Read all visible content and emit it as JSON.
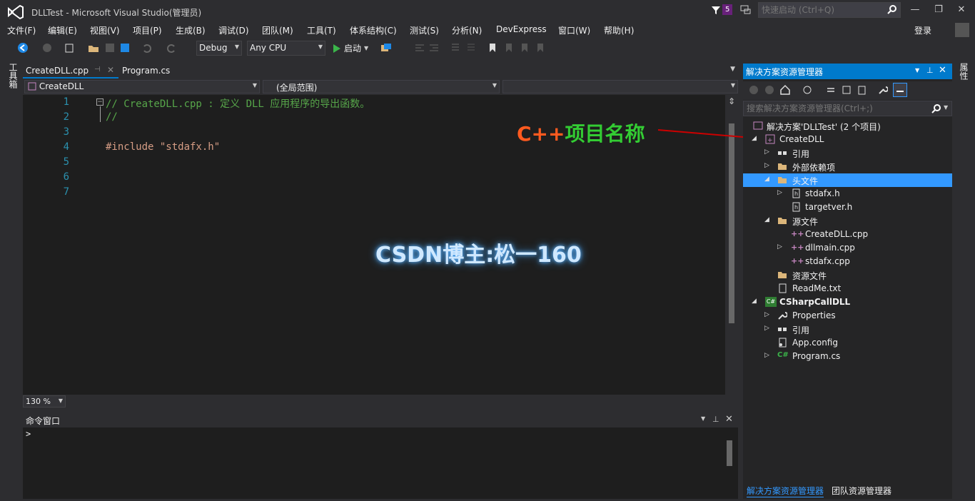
{
  "window": {
    "title": "DLLTest - Microsoft Visual Studio(管理员)",
    "notification_count": "5",
    "quick_launch_placeholder": "快速启动 (Ctrl+Q)",
    "login": "登录"
  },
  "menu": [
    "文件(F)",
    "编辑(E)",
    "视图(V)",
    "项目(P)",
    "生成(B)",
    "调试(D)",
    "团队(M)",
    "工具(T)",
    "体系结构(C)",
    "测试(S)",
    "分析(N)",
    "DevExpress",
    "窗口(W)",
    "帮助(H)"
  ],
  "toolbar": {
    "config": "Debug",
    "platform": "Any CPU",
    "start_label": "启动"
  },
  "side": {
    "toolbox": "工具箱",
    "properties": "属性"
  },
  "editor": {
    "tabs": [
      "CreateDLL.cpp",
      "Program.cs"
    ],
    "nav_project": "CreateDLL",
    "nav_scope": "(全局范围)",
    "zoom": "130 %",
    "line_numbers": [
      "1",
      "2",
      "3",
      "4",
      "5",
      "6",
      "7"
    ],
    "lines": [
      "// CreateDLL.cpp : 定义 DLL 应用程序的导出函数。",
      "//",
      "",
      "#include \"stdafx.h\"",
      "",
      "",
      ""
    ]
  },
  "command_window": {
    "title": "命令窗口",
    "prompt": ">"
  },
  "solution_explorer": {
    "title": "解决方案资源管理器",
    "search_placeholder": "搜索解决方案资源管理器(Ctrl+;)",
    "items": [
      {
        "label": "解决方案'DLLTest' (2 个项目)",
        "icon": "solution-icon"
      },
      {
        "label": "CreateDLL",
        "icon": "cpp-project-icon"
      },
      {
        "label": "引用",
        "icon": "references-icon"
      },
      {
        "label": "外部依赖项",
        "icon": "folder-icon"
      },
      {
        "label": "头文件",
        "icon": "folder-icon"
      },
      {
        "label": "stdafx.h",
        "icon": "header-file-icon"
      },
      {
        "label": "targetver.h",
        "icon": "header-file-icon"
      },
      {
        "label": "源文件",
        "icon": "folder-icon"
      },
      {
        "label": "CreateDLL.cpp",
        "icon": "cpp-file-icon"
      },
      {
        "label": "dllmain.cpp",
        "icon": "cpp-file-icon"
      },
      {
        "label": "stdafx.cpp",
        "icon": "cpp-file-icon"
      },
      {
        "label": "资源文件",
        "icon": "folder-icon"
      },
      {
        "label": "ReadMe.txt",
        "icon": "text-file-icon"
      },
      {
        "label": "CSharpCallDLL",
        "icon": "csharp-project-icon"
      },
      {
        "label": "Properties",
        "icon": "wrench-icon"
      },
      {
        "label": "引用",
        "icon": "references-icon"
      },
      {
        "label": "App.config",
        "icon": "config-file-icon"
      },
      {
        "label": "Program.cs",
        "icon": "csharp-file-icon"
      }
    ],
    "bottom_tabs": [
      "解决方案资源管理器",
      "团队资源管理器"
    ]
  },
  "annotation": {
    "part1": "C++",
    "part2": "项目",
    "part3": "名称"
  },
  "watermark": "CSDN博主:松一160",
  "colors": {
    "accent": "#007acc",
    "selection": "#3399ff",
    "comment": "#57a64a",
    "string": "#d69d85",
    "line_number": "#2b91af",
    "arrow": "#cc0000"
  }
}
